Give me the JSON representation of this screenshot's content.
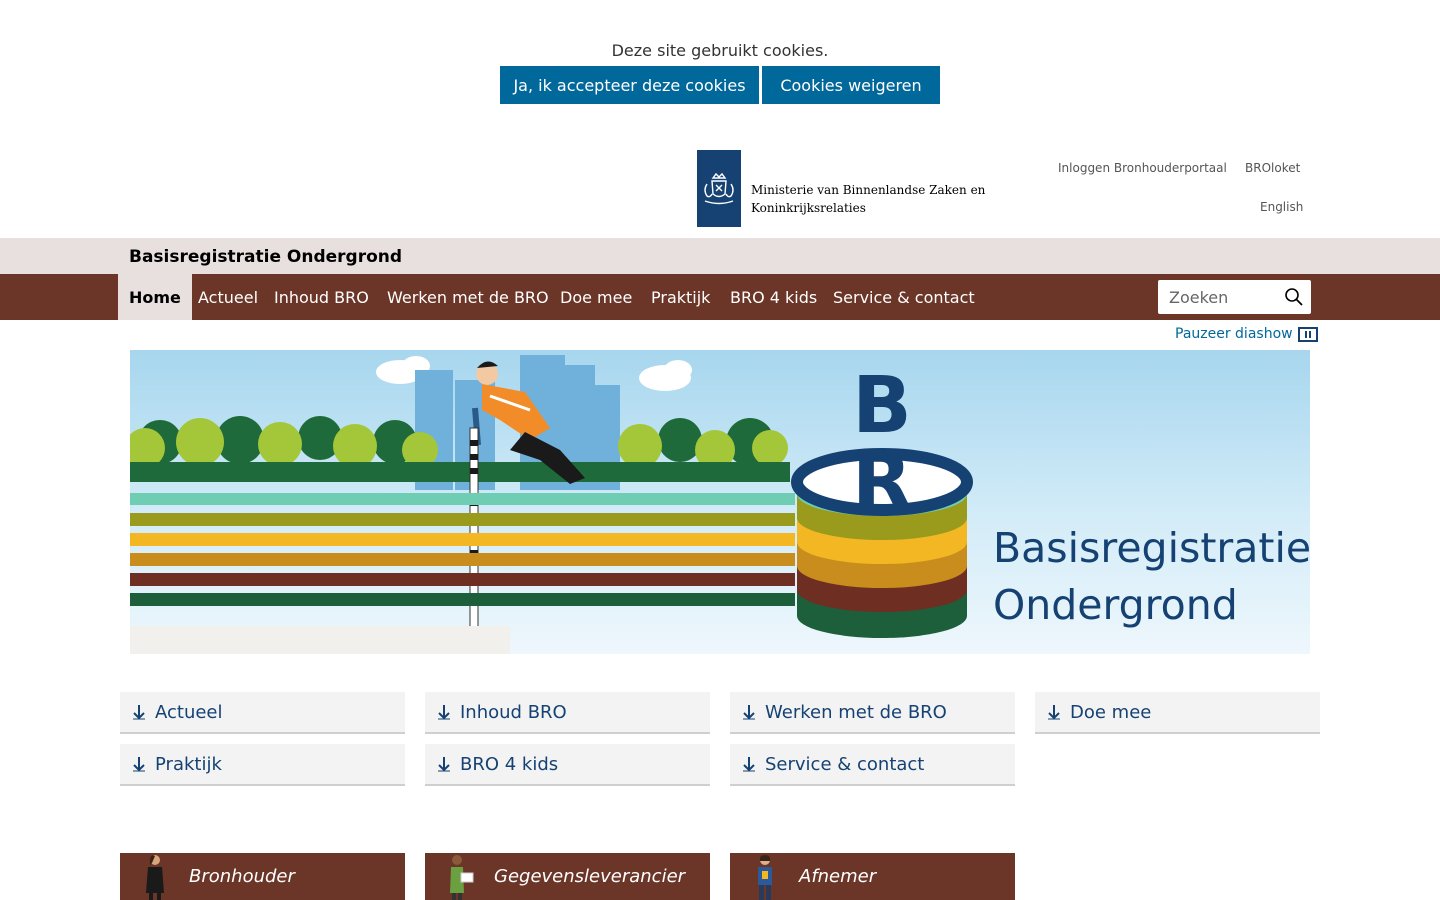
{
  "cookie_bar": {
    "message": "Deze site gebruikt cookies.",
    "accept_label": "Ja, ik accepteer deze cookies",
    "decline_label": "Cookies weigeren"
  },
  "header": {
    "ministry_line1": "Ministerie van Binnenlandse Zaken en",
    "ministry_line2": "Koninkrijksrelaties",
    "util_links": {
      "login": "Inloggen Bronhouderportaal",
      "broloket": "BROloket",
      "english": "English"
    },
    "site_title": "Basisregistratie Ondergrond"
  },
  "nav": {
    "items": [
      "Home",
      "Actueel",
      "Inhoud BRO",
      "Werken met de BRO",
      "Doe mee",
      "Praktijk",
      "BRO 4 kids",
      "Service & contact"
    ],
    "active": "Home",
    "search_placeholder": "Zoeken"
  },
  "slideshow": {
    "pause_label": "Pauzeer diashow",
    "logo_letters": [
      "B",
      "R"
    ],
    "caption_line1": "Basisregistratie",
    "caption_line2": "Ondergrond"
  },
  "quick_links": [
    "Actueel",
    "Inhoud BRO",
    "Werken met de BRO",
    "Doe mee",
    "Praktijk",
    "BRO 4 kids",
    "Service & contact"
  ],
  "roles": [
    "Bronhouder",
    "Gegevensleverancier",
    "Afnemer"
  ],
  "colors": {
    "brand_blue": "#01689b",
    "dark_blue": "#154273",
    "nav_brown": "#6b3528",
    "band_grey": "#e8e0df"
  }
}
